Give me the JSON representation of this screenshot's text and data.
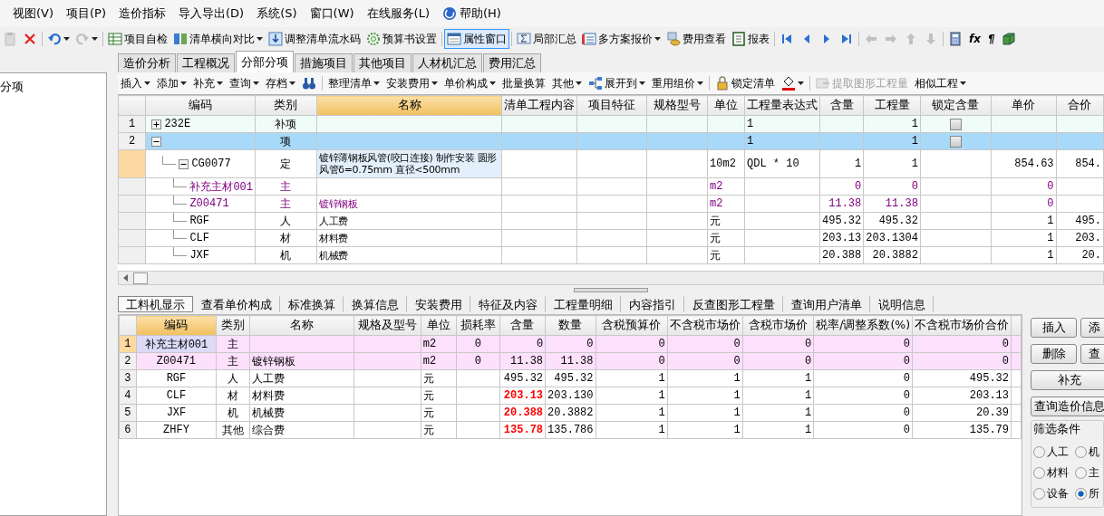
{
  "menu": [
    {
      "label": "视图(V)"
    },
    {
      "label": "项目(P)"
    },
    {
      "label": "造价指标"
    },
    {
      "label": "导入导出(D)"
    },
    {
      "label": "系统(S)"
    },
    {
      "label": "窗口(W)"
    },
    {
      "label": "在线服务(L)"
    },
    {
      "label": "帮助(H)",
      "kind": "help"
    }
  ],
  "toolbar": [
    {
      "kind": "icon",
      "disabled": true,
      "dropdown": false
    },
    {
      "kind": "icon",
      "disabled": false,
      "dropdown": false
    },
    {
      "kind": "separator"
    },
    {
      "kind": "icon",
      "disabled": false,
      "dropdown": true
    },
    {
      "kind": "icon",
      "disabled": true,
      "dropdown": true
    },
    {
      "kind": "separator"
    },
    {
      "kind": "button",
      "label": "项目自检",
      "dropdown": false,
      "disabled": false,
      "pressed": false
    },
    {
      "kind": "button",
      "label": "清单横向对比",
      "dropdown": true,
      "disabled": false,
      "pressed": false
    },
    {
      "kind": "button",
      "label": "调整清单流水码",
      "dropdown": false,
      "disabled": false,
      "pressed": false
    },
    {
      "kind": "button",
      "label": "预算书设置",
      "dropdown": false,
      "disabled": false,
      "pressed": false
    },
    {
      "kind": "separator"
    },
    {
      "kind": "button",
      "label": "属性窗口",
      "dropdown": false,
      "disabled": false,
      "pressed": true
    },
    {
      "kind": "separator"
    },
    {
      "kind": "button",
      "label": "局部汇总",
      "dropdown": false,
      "disabled": false,
      "pressed": false
    },
    {
      "kind": "button",
      "label": "多方案报价",
      "dropdown": true,
      "disabled": false,
      "pressed": false
    },
    {
      "kind": "button",
      "label": "费用查看",
      "dropdown": false,
      "disabled": false,
      "pressed": false
    },
    {
      "kind": "button",
      "label": "报表",
      "dropdown": false,
      "disabled": false,
      "pressed": false
    },
    {
      "kind": "separator"
    },
    {
      "kind": "icon",
      "disabled": false,
      "dropdown": false
    },
    {
      "kind": "icon",
      "disabled": false,
      "dropdown": false
    },
    {
      "kind": "icon",
      "disabled": false,
      "dropdown": false
    },
    {
      "kind": "icon",
      "disabled": false,
      "dropdown": false
    },
    {
      "kind": "separator"
    },
    {
      "kind": "icon",
      "disabled": true,
      "dropdown": false
    },
    {
      "kind": "icon",
      "disabled": true,
      "dropdown": false
    },
    {
      "kind": "icon",
      "disabled": true,
      "dropdown": false
    },
    {
      "kind": "icon",
      "disabled": true,
      "dropdown": false
    },
    {
      "kind": "separator"
    },
    {
      "kind": "icon",
      "disabled": false,
      "dropdown": false
    },
    {
      "kind": "glyph",
      "label": "fx",
      "disabled": false,
      "dropdown": false
    },
    {
      "kind": "glyph",
      "label": "¶",
      "disabled": false,
      "dropdown": false
    },
    {
      "kind": "icon",
      "disabled": false,
      "dropdown": false
    }
  ],
  "left_panel": {
    "title": "分项"
  },
  "tabs": [
    {
      "label": "造价分析",
      "selected": false
    },
    {
      "label": "工程概况",
      "selected": false
    },
    {
      "label": "分部分项",
      "selected": true
    },
    {
      "label": "措施项目",
      "selected": false
    },
    {
      "label": "其他项目",
      "selected": false
    },
    {
      "label": "人材机汇总",
      "selected": false
    },
    {
      "label": "费用汇总",
      "selected": false
    }
  ],
  "edit_toolbar": [
    {
      "kind": "button",
      "label": "插入",
      "dropdown": true,
      "disabled": false
    },
    {
      "kind": "button",
      "label": "添加",
      "dropdown": true,
      "disabled": false
    },
    {
      "kind": "button",
      "label": "补充",
      "dropdown": true,
      "disabled": false
    },
    {
      "kind": "button",
      "label": "查询",
      "dropdown": true,
      "disabled": false
    },
    {
      "kind": "button",
      "label": "存档",
      "dropdown": true,
      "disabled": false
    },
    {
      "kind": "icon",
      "dropdown": false,
      "disabled": false
    },
    {
      "kind": "separator"
    },
    {
      "kind": "button",
      "label": "整理清单",
      "dropdown": true,
      "disabled": false
    },
    {
      "kind": "button",
      "label": "安装费用",
      "dropdown": true,
      "disabled": false
    },
    {
      "kind": "button",
      "label": "单价构成",
      "dropdown": true,
      "disabled": false
    },
    {
      "kind": "button",
      "label": "批量换算",
      "dropdown": false,
      "disabled": false
    },
    {
      "kind": "button",
      "label": "其他",
      "dropdown": true,
      "disabled": false
    },
    {
      "kind": "button",
      "label": "展开到",
      "dropdown": true,
      "disabled": false
    },
    {
      "kind": "button",
      "label": "重用组价",
      "dropdown": true,
      "disabled": false
    },
    {
      "kind": "separator"
    },
    {
      "kind": "button",
      "label": "锁定清单",
      "dropdown": false,
      "disabled": false
    },
    {
      "kind": "icon",
      "dropdown": true,
      "disabled": false
    },
    {
      "kind": "separator"
    },
    {
      "kind": "button",
      "label": "提取图形工程量",
      "dropdown": false,
      "disabled": true
    },
    {
      "kind": "button",
      "label": "相似工程",
      "dropdown": true,
      "disabled": false
    }
  ],
  "top_grid": {
    "columns": [
      {
        "selected": false
      },
      {
        "label": "编码",
        "selected": false
      },
      {
        "label": "类别",
        "selected": false
      },
      {
        "label": "名称",
        "selected": true
      },
      {
        "label": "清单工程内容",
        "selected": false
      },
      {
        "label": "项目特征",
        "selected": false
      },
      {
        "label": "规格型号",
        "selected": false
      },
      {
        "label": "单位",
        "selected": false
      },
      {
        "label": "工程量表达式",
        "selected": false
      },
      {
        "label": "含量",
        "selected": false
      },
      {
        "label": "工程量",
        "selected": false
      },
      {
        "label": "锁定含量",
        "selected": false
      },
      {
        "label": "单价",
        "selected": false
      },
      {
        "label": "合价",
        "selected": false
      }
    ],
    "rows": [
      {
        "num": "1",
        "code": "232E",
        "type": "补项",
        "kind": "supplement",
        "expr": "1",
        "quantity": "1",
        "locked": false,
        "expanded": false,
        "selected": false,
        "current": false
      },
      {
        "num": "2",
        "code": "",
        "type": "项",
        "kind": "item",
        "expr": "1",
        "quantity": "1",
        "locked": false,
        "expanded": true,
        "selected": true,
        "current": false,
        "children": [
          {
            "code": "CG0077",
            "type": "定",
            "kind": "quota",
            "name": "镀锌薄钢板风管(咬口连接) 制作安装 圆形风管δ=0.75mm 直径<500mm",
            "unit": "10m2",
            "expr": "QDL * 10",
            "ratio": "1",
            "quantity": "1",
            "unit_price": "854.63",
            "total": "854.",
            "expanded": true,
            "selected": false,
            "current": true,
            "children": [
              {
                "code": "补充主材001",
                "type": "主",
                "kind": "main_material",
                "unit": "m2",
                "ratio": "0",
                "quantity": "0",
                "unit_price": "0",
                "selected": false,
                "current": false
              },
              {
                "code": "Z00471",
                "type": "主",
                "kind": "main_material",
                "name": "镀锌钢板",
                "unit": "m2",
                "ratio": "11.38",
                "quantity": "11.38",
                "unit_price": "0",
                "selected": false,
                "current": false
              },
              {
                "code": "RGF",
                "type": "人",
                "kind": "cost",
                "name": "人工费",
                "unit": "元",
                "ratio": "495.32",
                "quantity": "495.32",
                "unit_price": "1",
                "total": "495.",
                "selected": false,
                "current": false
              },
              {
                "code": "CLF",
                "type": "材",
                "kind": "cost",
                "name": "材料费",
                "unit": "元",
                "ratio": "203.13",
                "quantity": "203.1304",
                "unit_price": "1",
                "total": "203.",
                "selected": false,
                "current": false
              },
              {
                "code": "JXF",
                "type": "机",
                "kind": "cost",
                "name": "机械费",
                "unit": "元",
                "ratio": "20.388",
                "quantity": "20.3882",
                "unit_price": "1",
                "total": "20.",
                "selected": false,
                "current": false
              }
            ]
          }
        ]
      }
    ]
  },
  "detail_tabs": [
    {
      "label": "工料机显示",
      "selected": true
    },
    {
      "label": "查看单价构成",
      "selected": false
    },
    {
      "label": "标准换算",
      "selected": false
    },
    {
      "label": "换算信息",
      "selected": false
    },
    {
      "label": "安装费用",
      "selected": false
    },
    {
      "label": "特征及内容",
      "selected": false
    },
    {
      "label": "工程量明细",
      "selected": false
    },
    {
      "label": "内容指引",
      "selected": false
    },
    {
      "label": "反查图形工程量",
      "selected": false
    },
    {
      "label": "查询用户清单",
      "selected": false
    },
    {
      "label": "说明信息",
      "selected": false
    }
  ],
  "detail_grid": {
    "columns": [
      {
        "selected": false
      },
      {
        "label": "编码",
        "selected": true
      },
      {
        "label": "类别",
        "selected": false
      },
      {
        "label": "名称",
        "selected": false
      },
      {
        "label": "规格及型号",
        "selected": false
      },
      {
        "label": "单位",
        "selected": false
      },
      {
        "label": "损耗率",
        "selected": false
      },
      {
        "label": "含量",
        "selected": false
      },
      {
        "label": "数量",
        "selected": false
      },
      {
        "label": "含税预算价",
        "selected": false
      },
      {
        "label": "不含税市场价",
        "selected": false
      },
      {
        "label": "含税市场价",
        "selected": false
      },
      {
        "label": "税率/调整系数(%)",
        "selected": false
      },
      {
        "label": "不含税市场价合价",
        "selected": false
      }
    ],
    "rows": [
      {
        "num": "1",
        "code": "补充主材001",
        "type": "主",
        "kind": "main_material",
        "name": "",
        "unit": "m2",
        "loss": "0",
        "ratio": "0",
        "quantity": "0",
        "tax_budget": "0",
        "market_ex": "0",
        "market_inc": "0",
        "rate": "0",
        "total_ex": "0",
        "current": true,
        "ratio_modified": false
      },
      {
        "num": "2",
        "code": "Z00471",
        "type": "主",
        "kind": "main_material",
        "name": "镀锌钢板",
        "unit": "m2",
        "loss": "0",
        "ratio": "11.38",
        "quantity": "11.38",
        "tax_budget": "0",
        "market_ex": "0",
        "market_inc": "0",
        "rate": "0",
        "total_ex": "0",
        "current": false,
        "ratio_modified": false
      },
      {
        "num": "3",
        "code": "RGF",
        "type": "人",
        "kind": "cost",
        "name": "人工费",
        "unit": "元",
        "ratio": "495.32",
        "quantity": "495.32",
        "tax_budget": "1",
        "market_ex": "1",
        "market_inc": "1",
        "rate": "0",
        "total_ex": "495.32",
        "current": false,
        "ratio_modified": false
      },
      {
        "num": "4",
        "code": "CLF",
        "type": "材",
        "kind": "cost",
        "name": "材料费",
        "unit": "元",
        "ratio": "203.13",
        "quantity": "203.130",
        "tax_budget": "1",
        "market_ex": "1",
        "market_inc": "1",
        "rate": "0",
        "total_ex": "203.13",
        "current": false,
        "ratio_modified": true
      },
      {
        "num": "5",
        "code": "JXF",
        "type": "机",
        "kind": "cost",
        "name": "机械费",
        "unit": "元",
        "ratio": "20.388",
        "quantity": "20.3882",
        "tax_budget": "1",
        "market_ex": "1",
        "market_inc": "1",
        "rate": "0",
        "total_ex": "20.39",
        "current": false,
        "ratio_modified": true
      },
      {
        "num": "6",
        "code": "ZHFY",
        "type": "其他",
        "kind": "cost",
        "name": "综合费",
        "unit": "元",
        "ratio": "135.78",
        "quantity": "135.786",
        "tax_budget": "1",
        "market_ex": "1",
        "market_inc": "1",
        "rate": "0",
        "total_ex": "135.79",
        "current": false,
        "ratio_modified": true
      }
    ]
  },
  "side_buttons": [
    {
      "label": "插入"
    },
    {
      "label": "添"
    },
    {
      "label": "删除"
    },
    {
      "label": "查"
    },
    {
      "label": "补充",
      "kind": "wide"
    },
    {
      "label": "查询造价信息",
      "kind": "wide"
    }
  ],
  "filter": {
    "title": "筛选条件",
    "options": [
      {
        "label": "人工",
        "selected": false
      },
      {
        "label": "机",
        "selected": false
      },
      {
        "label": "材料",
        "selected": false
      },
      {
        "label": "主",
        "selected": false
      },
      {
        "label": "设备",
        "selected": false
      },
      {
        "label": "所",
        "selected": true
      }
    ]
  }
}
